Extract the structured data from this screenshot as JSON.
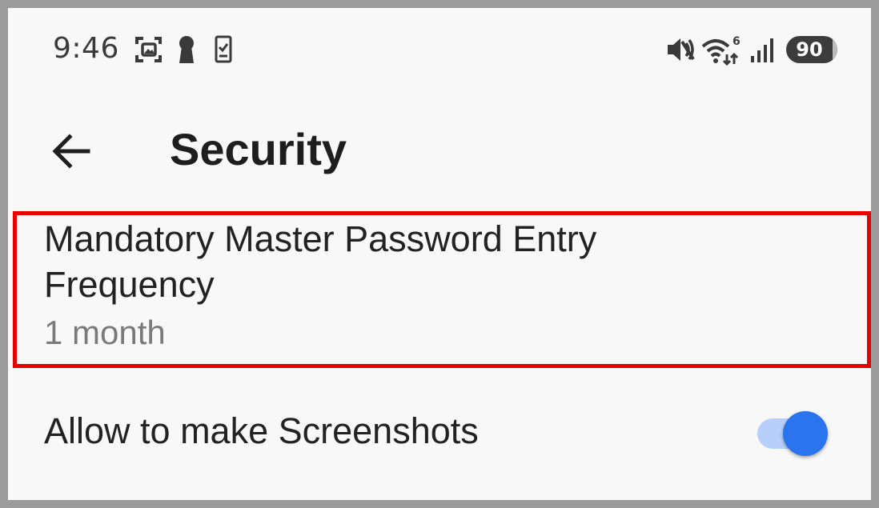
{
  "status_bar": {
    "time": "9:46",
    "battery_level": "90",
    "network_badge": "6",
    "icons": [
      "screenshot-icon",
      "keyhole-icon",
      "phone-check-icon",
      "vibrate-mute-icon",
      "wifi-icon",
      "signal-icon",
      "battery-icon"
    ]
  },
  "header": {
    "title": "Security",
    "back_icon": "arrow-left-icon"
  },
  "settings": {
    "items": [
      {
        "title": "Mandatory Master Password Entry Frequency",
        "summary": "1 month"
      },
      {
        "title": "Allow to make Screenshots",
        "toggle_on": true
      }
    ]
  },
  "colors": {
    "highlight": "#e80000",
    "switch_thumb": "#2a74ee",
    "switch_track": "#b7cffa"
  }
}
